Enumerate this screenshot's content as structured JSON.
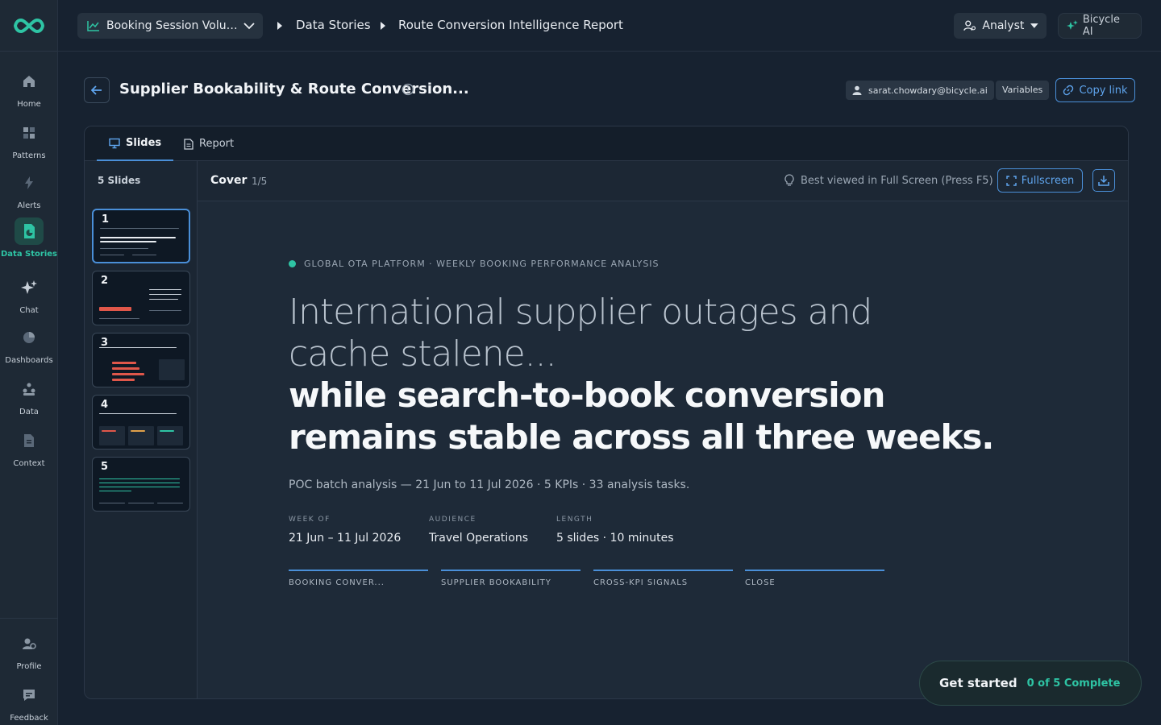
{
  "rail": {
    "items": [
      {
        "label": "Home",
        "icon": "home-icon"
      },
      {
        "label": "Patterns",
        "icon": "patterns-icon"
      },
      {
        "label": "Alerts",
        "icon": "bolt-icon"
      },
      {
        "label": "Data Stories",
        "icon": "data-stories-icon",
        "active": true
      },
      {
        "label": "Chat",
        "icon": "sparkle-icon"
      },
      {
        "label": "Dashboards",
        "icon": "pie-icon"
      },
      {
        "label": "Data",
        "icon": "data-icon"
      },
      {
        "label": "Context",
        "icon": "document-icon"
      }
    ],
    "bottom": [
      {
        "label": "Profile",
        "icon": "profile-icon"
      },
      {
        "label": "Feedback",
        "icon": "feedback-icon"
      }
    ]
  },
  "topbar": {
    "dataset": "Booking Session Volume...",
    "breadcrumb": [
      "Data Stories",
      "Route Conversion Intelligence Report"
    ],
    "role": "Analyst",
    "ai_label": "Bicycle AI"
  },
  "header": {
    "title": "Supplier Bookability & Route Conversion...",
    "user": "sarat.chowdary@bicycle.ai",
    "variables_label": "Variables",
    "copy_label": "Copy link"
  },
  "tabs": [
    {
      "label": "Slides",
      "active": true
    },
    {
      "label": "Report",
      "active": false
    }
  ],
  "thumbs": {
    "count_label": "5 Slides",
    "slides": [
      {
        "num": "1"
      },
      {
        "num": "2"
      },
      {
        "num": "3"
      },
      {
        "num": "4"
      },
      {
        "num": "5"
      }
    ]
  },
  "viewer": {
    "slide_name": "Cover",
    "slide_count": "1/5",
    "hint": "Best viewed in Full Screen (Press F5)",
    "fullscreen_label": "Fullscreen"
  },
  "slide": {
    "eyebrow": "GLOBAL OTA PLATFORM · WEEKLY BOOKING PERFORMANCE ANALYSIS",
    "headline_light": "International supplier outages and cache stalene...",
    "headline_bold": "while search-to-book conversion remains stable across all three weeks.",
    "subline": "POC batch analysis — 21 Jun to 11 Jul 2026 · 5 KPIs · 33 analysis tasks.",
    "meta": [
      {
        "key": "WEEK OF",
        "value": "21 Jun – 11 Jul 2026"
      },
      {
        "key": "AUDIENCE",
        "value": "Travel Operations"
      },
      {
        "key": "LENGTH",
        "value": "5 slides · 10 minutes"
      }
    ],
    "sections": [
      "BOOKING CONVER...",
      "SUPPLIER BOOKABILITY",
      "CROSS-KPI SIGNALS",
      "CLOSE"
    ]
  },
  "get_started": {
    "title": "Get started",
    "progress": "0 of 5 Complete"
  },
  "colors": {
    "accent": "#4a8fd8",
    "brand": "#2ec4a4",
    "background": "#172230"
  }
}
